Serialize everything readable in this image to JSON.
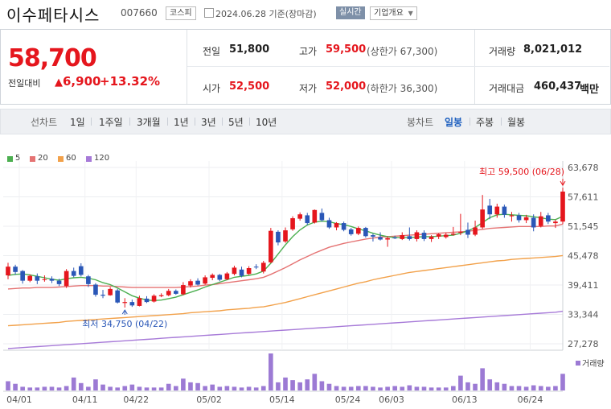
{
  "header": {
    "stock_name": "이수페타시스",
    "stock_code": "007660",
    "market_badge": "코스피",
    "as_of": "2024.06.28 기준(장마감)",
    "realtime_label": "실시간",
    "company_info_label": "기업개요"
  },
  "summary": {
    "price": "58,700",
    "compare_label": "전일대비",
    "change": "6,900",
    "change_pct": "+13.32%",
    "prev_close_label": "전일",
    "prev_close": "51,800",
    "open_label": "시가",
    "open": "52,500",
    "high_label": "고가",
    "high": "59,500",
    "upper_limit": "(상한가 67,300)",
    "low_label": "저가",
    "low": "52,000",
    "lower_limit": "(하한가 36,300)",
    "volume_label": "거래량",
    "volume": "8,021,012",
    "value_label": "거래대금",
    "value": "460,437",
    "value_unit": "백만"
  },
  "period_bar": {
    "line_label": "선차트",
    "line_tabs": [
      "1일",
      "1주일",
      "3개월",
      "1년",
      "3년",
      "5년",
      "10년"
    ],
    "candle_label": "봉차트",
    "candle_tabs": [
      "일봉",
      "주봉",
      "월봉"
    ],
    "selected_candle": "일봉"
  },
  "colors": {
    "up": "#e5161d",
    "down": "#2a57b7",
    "ma5": "#4caf50",
    "ma20": "#e57373",
    "ma60": "#f2a14a",
    "ma120": "#a77ad8"
  },
  "chart_data": {
    "type": "candlestick",
    "legend": [
      "5",
      "20",
      "60",
      "120"
    ],
    "y_ticks": [
      "63,678",
      "57,611",
      "51,545",
      "45,478",
      "39,411",
      "33,344",
      "27,278"
    ],
    "ylim": [
      27278,
      63678
    ],
    "x_ticks": [
      "04/01",
      "04/11",
      "04/22",
      "05/02",
      "05/14",
      "05/24",
      "06/03",
      "06/13",
      "06/24"
    ],
    "high_annotation": "최고 59,500 (06/28)",
    "low_annotation": "최저 34,750 (04/22)",
    "volume_label": "거래량",
    "candles": [
      [
        41400,
        43200,
        44000,
        40600
      ],
      [
        43200,
        42100,
        43600,
        41500
      ],
      [
        42300,
        40300,
        42500,
        39700
      ],
      [
        40300,
        41300,
        41600,
        40000
      ],
      [
        41200,
        40300,
        41800,
        39600
      ],
      [
        40500,
        40600,
        41400,
        40100
      ],
      [
        40700,
        40300,
        41200,
        39800
      ],
      [
        40300,
        39600,
        40700,
        39200
      ],
      [
        39200,
        42300,
        42700,
        38800
      ],
      [
        42300,
        41300,
        43000,
        41000
      ],
      [
        43300,
        41500,
        43900,
        41200
      ],
      [
        41200,
        39600,
        41500,
        39000
      ],
      [
        39500,
        37400,
        39800,
        37000
      ],
      [
        37400,
        37200,
        38400,
        36700
      ],
      [
        37300,
        38600,
        39000,
        37200
      ],
      [
        38300,
        35800,
        38600,
        35600
      ],
      [
        35700,
        35900,
        36700,
        34750
      ],
      [
        35900,
        35200,
        36400,
        34900
      ],
      [
        35100,
        36700,
        37200,
        35000
      ],
      [
        36600,
        35900,
        37100,
        35700
      ],
      [
        36000,
        37200,
        37500,
        35800
      ],
      [
        37100,
        37300,
        37700,
        36900
      ],
      [
        37300,
        38200,
        38600,
        37100
      ],
      [
        38200,
        37600,
        38500,
        37400
      ],
      [
        37500,
        39400,
        40000,
        37300
      ],
      [
        39300,
        40200,
        40600,
        38900
      ],
      [
        40300,
        39500,
        40800,
        39300
      ],
      [
        39700,
        41000,
        41400,
        39500
      ],
      [
        40900,
        41500,
        41800,
        40400
      ],
      [
        41500,
        40500,
        41700,
        40200
      ],
      [
        40600,
        41800,
        42100,
        40400
      ],
      [
        41700,
        43000,
        43400,
        41400
      ],
      [
        42600,
        41300,
        43200,
        41000
      ],
      [
        41700,
        42900,
        43300,
        41500
      ],
      [
        43200,
        43100,
        43700,
        42700
      ],
      [
        42200,
        44000,
        44400,
        41800
      ],
      [
        44100,
        50600,
        51200,
        43900
      ],
      [
        50400,
        48200,
        50700,
        47600
      ],
      [
        48400,
        50700,
        51300,
        48100
      ],
      [
        50900,
        53200,
        53600,
        50600
      ],
      [
        53100,
        54000,
        54400,
        52700
      ],
      [
        53800,
        52200,
        54300,
        51800
      ],
      [
        52300,
        54900,
        55000,
        52100
      ],
      [
        54300,
        52800,
        55200,
        52500
      ],
      [
        52800,
        51300,
        53300,
        51000
      ],
      [
        51300,
        52200,
        52400,
        50700
      ],
      [
        52200,
        50800,
        52500,
        50500
      ],
      [
        50900,
        49900,
        51200,
        49600
      ],
      [
        50000,
        51200,
        51500,
        49700
      ],
      [
        51200,
        49500,
        51400,
        49200
      ],
      [
        49700,
        49400,
        50000,
        48400
      ],
      [
        49300,
        48800,
        50300,
        48600
      ],
      [
        48800,
        49100,
        49500,
        47300
      ],
      [
        49200,
        49100,
        49600,
        48900
      ],
      [
        48900,
        49700,
        50300,
        48700
      ],
      [
        49500,
        48900,
        51300,
        48600
      ],
      [
        48900,
        50300,
        50700,
        48400
      ],
      [
        50200,
        48900,
        50700,
        48500
      ],
      [
        48900,
        49400,
        49700,
        48300
      ],
      [
        49400,
        49900,
        50100,
        48900
      ],
      [
        49300,
        49800,
        50200,
        49000
      ],
      [
        49800,
        50000,
        51400,
        49600
      ],
      [
        50200,
        50400,
        54100,
        49700
      ],
      [
        50800,
        49800,
        52300,
        49100
      ],
      [
        49800,
        51300,
        52700,
        49500
      ],
      [
        51300,
        55000,
        58000,
        51000
      ],
      [
        55800,
        54000,
        57200,
        53000
      ],
      [
        54000,
        55600,
        56200,
        53300
      ],
      [
        55600,
        53900,
        56000,
        53300
      ],
      [
        53600,
        53800,
        54500,
        52500
      ],
      [
        53800,
        52800,
        54300,
        52300
      ],
      [
        52800,
        53400,
        53900,
        52200
      ],
      [
        53300,
        51300,
        54000,
        50500
      ],
      [
        51600,
        53600,
        54500,
        51300
      ],
      [
        53800,
        52500,
        54300,
        52000
      ],
      [
        52200,
        52500,
        52900,
        51200
      ],
      [
        52500,
        58700,
        59500,
        52000
      ]
    ],
    "volumes": [
      0.25,
      0.18,
      0.1,
      0.08,
      0.08,
      0.1,
      0.1,
      0.08,
      0.12,
      0.35,
      0.2,
      0.1,
      0.3,
      0.16,
      0.1,
      0.08,
      0.12,
      0.16,
      0.1,
      0.08,
      0.08,
      0.08,
      0.18,
      0.12,
      0.32,
      0.22,
      0.2,
      0.12,
      0.16,
      0.1,
      0.12,
      0.1,
      0.08,
      0.1,
      0.08,
      0.12,
      1.0,
      0.22,
      0.35,
      0.28,
      0.22,
      0.3,
      0.45,
      0.25,
      0.18,
      0.12,
      0.1,
      0.1,
      0.12,
      0.12,
      0.1,
      0.08,
      0.1,
      0.12,
      0.1,
      0.14,
      0.1,
      0.1,
      0.08,
      0.08,
      0.08,
      0.12,
      0.4,
      0.22,
      0.18,
      0.6,
      0.3,
      0.22,
      0.18,
      0.12,
      0.12,
      0.1,
      0.14,
      0.12,
      0.1,
      0.12,
      0.45
    ],
    "ma5": [
      41400,
      41600,
      41700,
      41500,
      41200,
      40900,
      40600,
      40400,
      40700,
      40900,
      41000,
      40800,
      40500,
      39900,
      39500,
      38800,
      38000,
      37200,
      36700,
      36300,
      36200,
      36300,
      36600,
      36900,
      37400,
      37900,
      38400,
      39000,
      39500,
      40000,
      40500,
      41000,
      41200,
      41400,
      41700,
      42300,
      43900,
      45800,
      47700,
      49400,
      50800,
      51800,
      52400,
      52600,
      52500,
      52100,
      51900,
      51500,
      51000,
      50600,
      50100,
      49700,
      49400,
      49200,
      49200,
      49200,
      49300,
      49400,
      49400,
      49500,
      49600,
      49700,
      50100,
      50600,
      51300,
      52300,
      53300,
      53900,
      54000,
      53900,
      53800,
      53700,
      53500,
      53300,
      53000,
      52900,
      53600
    ],
    "ma20": [
      38600,
      38700,
      38800,
      38800,
      38900,
      38900,
      38900,
      39000,
      39100,
      39200,
      39300,
      39300,
      39300,
      39200,
      39200,
      39100,
      39000,
      38900,
      38900,
      38900,
      38900,
      38900,
      38900,
      38900,
      39000,
      39100,
      39200,
      39400,
      39500,
      39700,
      39900,
      40100,
      40300,
      40500,
      40700,
      41000,
      41600,
      42300,
      43000,
      43800,
      44600,
      45300,
      46000,
      46600,
      47200,
      47600,
      48000,
      48300,
      48600,
      48900,
      49100,
      49300,
      49400,
      49500,
      49600,
      49700,
      49800,
      49900,
      50000,
      50100,
      50200,
      50300,
      50400,
      50500,
      50700,
      50900,
      51100,
      51200,
      51300,
      51400,
      51500,
      51500,
      51500,
      51500,
      51600,
      51600,
      52000
    ],
    "ma60": [
      31000,
      31100,
      31200,
      31300,
      31400,
      31500,
      31600,
      31700,
      31900,
      32000,
      32100,
      32200,
      32300,
      32400,
      32500,
      32600,
      32700,
      32800,
      32900,
      33000,
      33100,
      33200,
      33300,
      33400,
      33500,
      33700,
      33800,
      33900,
      34000,
      34100,
      34300,
      34400,
      34500,
      34600,
      34800,
      34900,
      35200,
      35500,
      35800,
      36200,
      36600,
      37000,
      37400,
      37800,
      38200,
      38600,
      39000,
      39400,
      39800,
      40100,
      40500,
      40800,
      41100,
      41400,
      41700,
      42000,
      42200,
      42400,
      42600,
      42800,
      43000,
      43200,
      43400,
      43600,
      43800,
      44000,
      44200,
      44400,
      44500,
      44700,
      44800,
      44900,
      45000,
      45100,
      45200,
      45300,
      45500
    ],
    "ma120": [
      26300,
      26400,
      26500,
      26600,
      26700,
      26800,
      26900,
      27000,
      27100,
      27200,
      27300,
      27400,
      27500,
      27600,
      27700,
      27800,
      27900,
      28000,
      28100,
      28200,
      28300,
      28400,
      28500,
      28600,
      28700,
      28800,
      28900,
      29000,
      29100,
      29200,
      29300,
      29400,
      29500,
      29600,
      29700,
      29800,
      29900,
      30000,
      30100,
      30200,
      30300,
      30400,
      30500,
      30600,
      30700,
      30800,
      30900,
      31000,
      31100,
      31200,
      31300,
      31400,
      31500,
      31600,
      31700,
      31800,
      31900,
      32000,
      32100,
      32200,
      32300,
      32400,
      32500,
      32600,
      32700,
      32800,
      32900,
      33000,
      33100,
      33200,
      33300,
      33400,
      33500,
      33600,
      33700,
      33800,
      34000
    ]
  }
}
